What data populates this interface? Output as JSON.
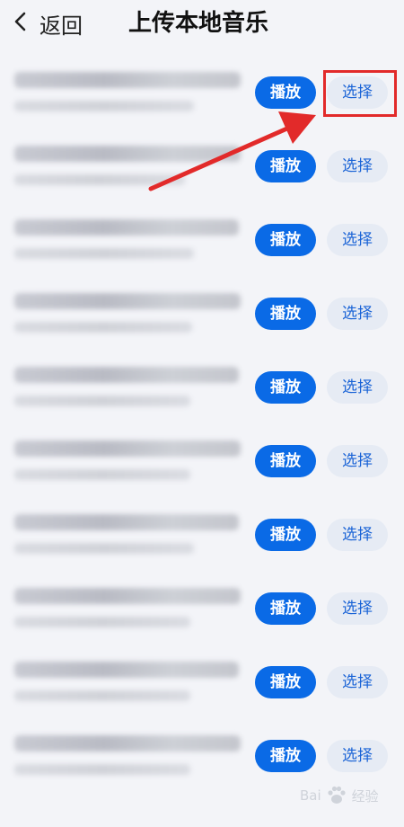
{
  "header": {
    "back_label": "返回",
    "title": "上传本地音乐"
  },
  "rows": [
    {
      "play_label": "播放",
      "select_label": "选择"
    },
    {
      "play_label": "播放",
      "select_label": "选择"
    },
    {
      "play_label": "播放",
      "select_label": "选择"
    },
    {
      "play_label": "播放",
      "select_label": "选择"
    },
    {
      "play_label": "播放",
      "select_label": "选择"
    },
    {
      "play_label": "播放",
      "select_label": "选择"
    },
    {
      "play_label": "播放",
      "select_label": "选择"
    },
    {
      "play_label": "播放",
      "select_label": "选择"
    },
    {
      "play_label": "播放",
      "select_label": "选择"
    },
    {
      "play_label": "播放",
      "select_label": "选择"
    }
  ],
  "watermark": {
    "brand_left": "Bai",
    "brand_right": "经验"
  },
  "colors": {
    "accent": "#0a6ae6",
    "select_bg": "#e6ebf4",
    "annotation": "#e22a2a"
  }
}
